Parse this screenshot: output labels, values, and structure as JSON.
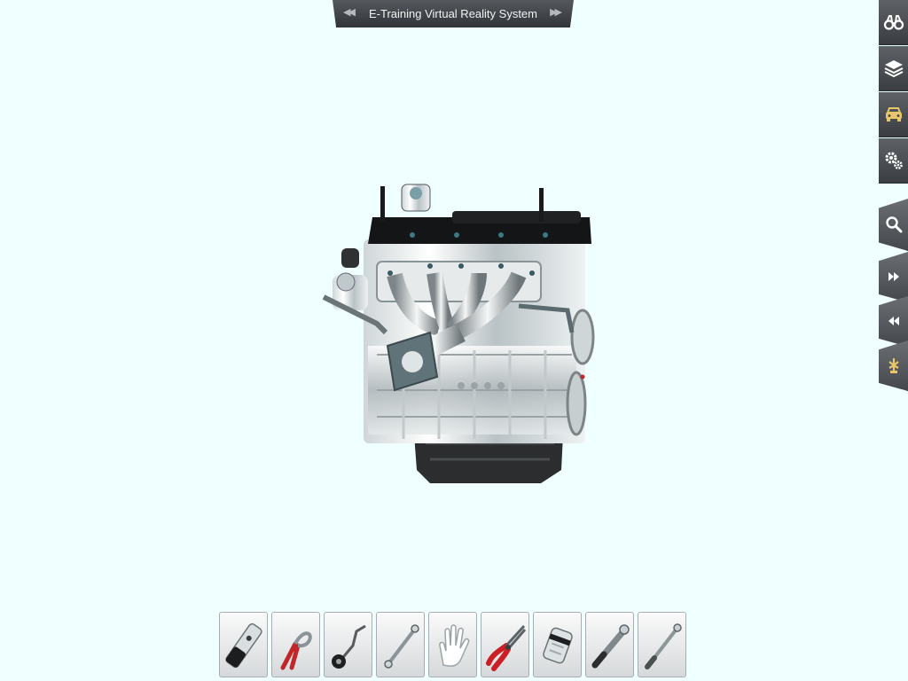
{
  "title_bar": {
    "title": "E-Training Virtual Reality System",
    "prev_icon": "double-chevron-left-icon",
    "next_icon": "double-chevron-right-icon"
  },
  "side_toolbar": [
    {
      "name": "view-button",
      "icon": "binoculars-icon"
    },
    {
      "name": "layers-button",
      "icon": "layers-icon"
    },
    {
      "name": "vehicle-button",
      "icon": "car-icon"
    },
    {
      "name": "settings-button",
      "icon": "gears-icon"
    },
    {
      "name": "search-button",
      "icon": "search-icon"
    },
    {
      "name": "step-forward-button",
      "icon": "fast-forward-icon"
    },
    {
      "name": "step-back-button",
      "icon": "rewind-icon"
    },
    {
      "name": "assemble-button",
      "icon": "assemble-icon"
    }
  ],
  "tools": [
    {
      "name": "spark-plug-socket",
      "icon": "spark-plug-socket-icon"
    },
    {
      "name": "snap-ring-pliers",
      "icon": "snap-ring-pliers-icon"
    },
    {
      "name": "oil-filter-wrench",
      "icon": "oil-filter-wrench-icon"
    },
    {
      "name": "extension-bar",
      "icon": "extension-bar-icon"
    },
    {
      "name": "hand",
      "icon": "hand-icon"
    },
    {
      "name": "pliers",
      "icon": "pliers-icon"
    },
    {
      "name": "socket",
      "icon": "socket-icon"
    },
    {
      "name": "ratchet-handle",
      "icon": "ratchet-handle-icon"
    },
    {
      "name": "torque-wrench",
      "icon": "torque-wrench-icon"
    }
  ],
  "colors": {
    "background": "#f0ffff",
    "toolbar_dark": "#3a3d41",
    "accent_gold": "#e8c66a"
  }
}
